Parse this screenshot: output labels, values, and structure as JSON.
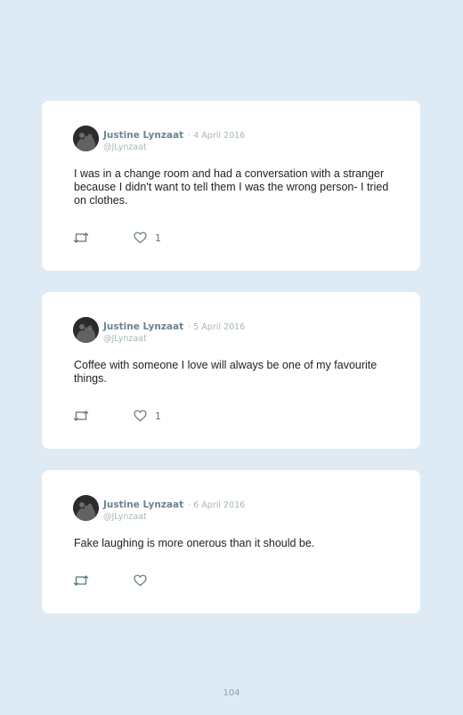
{
  "tweets": [
    {
      "name": "Justine Lynzaat",
      "date": "· 4 April 2016",
      "handle": "@JLynzaat",
      "text": "I was in a change room and had a conversation with a stranger because I didn't want to tell them I was the wrong person- I tried on clothes.",
      "likes": "1",
      "icons": [
        "retweet-icon",
        "heart-icon"
      ]
    },
    {
      "name": "Justine Lynzaat",
      "date": "· 5 April 2016",
      "handle": "@JLynzaat",
      "text": "Coffee with someone I love will always be one of my favourite things.",
      "likes": "1",
      "icons": [
        "retweet-icon",
        "heart-icon"
      ]
    },
    {
      "name": "Justine Lynzaat",
      "date": "· 6 April 2016",
      "handle": "@JLynzaat",
      "text": "Fake laughing is more onerous than it should be.",
      "likes": "",
      "icons": [
        "retweet-icon",
        "heart-icon"
      ]
    }
  ],
  "page_number": "104",
  "colors": {
    "background": "#deebf4",
    "card": "#ffffff",
    "name": "#6b8492",
    "muted": "#a6b6bf",
    "text": "#222222",
    "icon": "#5d7683"
  }
}
